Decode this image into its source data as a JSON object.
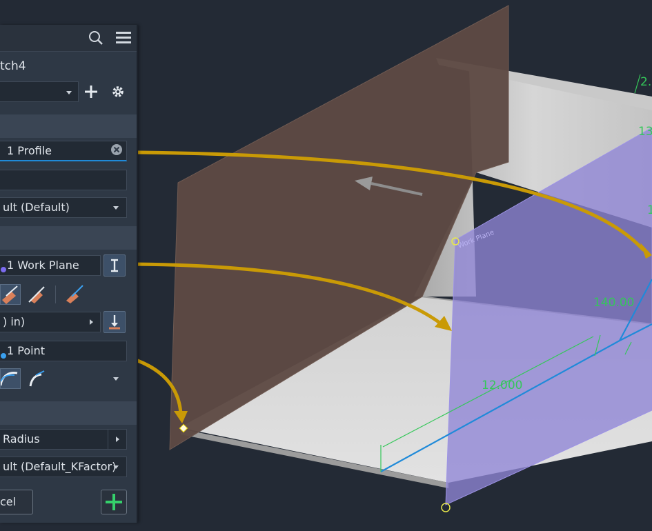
{
  "panel": {
    "title_fragment": "tch4",
    "profiles_label": "1 Profile",
    "style_value": "ult (Default)",
    "workplane_label": "1 Work Plane",
    "distance_value": ") in)",
    "point_label": "1 Point",
    "bend_value": "Radius",
    "unfold_value": "ult (Default_KFactor)",
    "cancel_label": "cel"
  },
  "viewport": {
    "dimensions": {
      "top_partial": "2.",
      "right_partial_1": "13",
      "right_partial_2": "1",
      "angle": "140.00",
      "length": "12.000"
    },
    "plane_tag": "Work Plane"
  },
  "icons": {
    "search": "search-icon",
    "menu": "hamburger-menu-icon",
    "add": "plus-icon",
    "settings": "gear-icon",
    "clear": "close-circle-icon",
    "flip": "flip-direction-icon",
    "ok": "plus-green-icon"
  },
  "colors": {
    "accent": "#1f8ad9",
    "dimension": "#34c759",
    "callout_arrow": "#c99a06",
    "workplane": "#8f85d6",
    "brown_plane": "#5e4a44"
  }
}
